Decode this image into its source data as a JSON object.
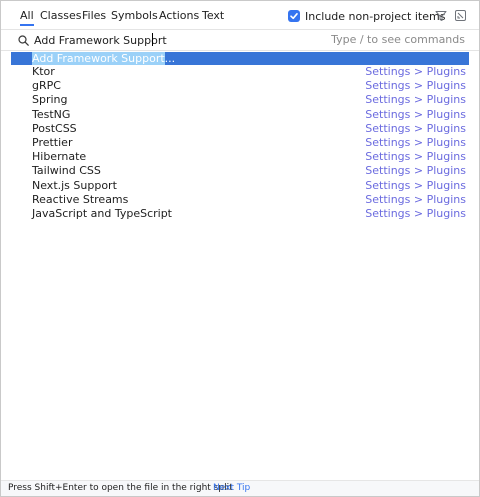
{
  "tabs": [
    {
      "label": "All",
      "selected": true
    },
    {
      "label": "Classes"
    },
    {
      "label": "Files"
    },
    {
      "label": "Symbols"
    },
    {
      "label": "Actions"
    },
    {
      "label": "Text"
    }
  ],
  "include_option": {
    "label": "Include non-project items",
    "checked": true
  },
  "icons": {
    "filter": "filter-icon",
    "collapse": "collapse-icon",
    "search": "search-icon",
    "checkmark": "checkmark-icon"
  },
  "search": {
    "value": "Add Framework Support",
    "hint": "Type / to see commands"
  },
  "results": [
    {
      "name_highlight": "Add Framework Support",
      "name_rest": "...",
      "location": ""
    },
    {
      "name": "Ktor",
      "location": "Settings > Plugins"
    },
    {
      "name": "gRPC",
      "location": "Settings > Plugins"
    },
    {
      "name": "Spring",
      "location": "Settings > Plugins"
    },
    {
      "name": "TestNG",
      "location": "Settings > Plugins"
    },
    {
      "name": "PostCSS",
      "location": "Settings > Plugins"
    },
    {
      "name": "Prettier",
      "location": "Settings > Plugins"
    },
    {
      "name": "Hibernate",
      "location": "Settings > Plugins"
    },
    {
      "name": "Tailwind CSS",
      "location": "Settings > Plugins"
    },
    {
      "name": "Next.js Support",
      "location": "Settings > Plugins"
    },
    {
      "name": "Reactive Streams",
      "location": "Settings > Plugins"
    },
    {
      "name": "JavaScript and TypeScript",
      "location": "Settings > Plugins"
    }
  ],
  "footer": {
    "tip": "Press Shift+Enter to open the file in the right split",
    "next_tip": "Next Tip"
  },
  "colors": {
    "accent": "#3574f0",
    "selection": "#3875d7",
    "location_text": "#6b6bdf"
  }
}
